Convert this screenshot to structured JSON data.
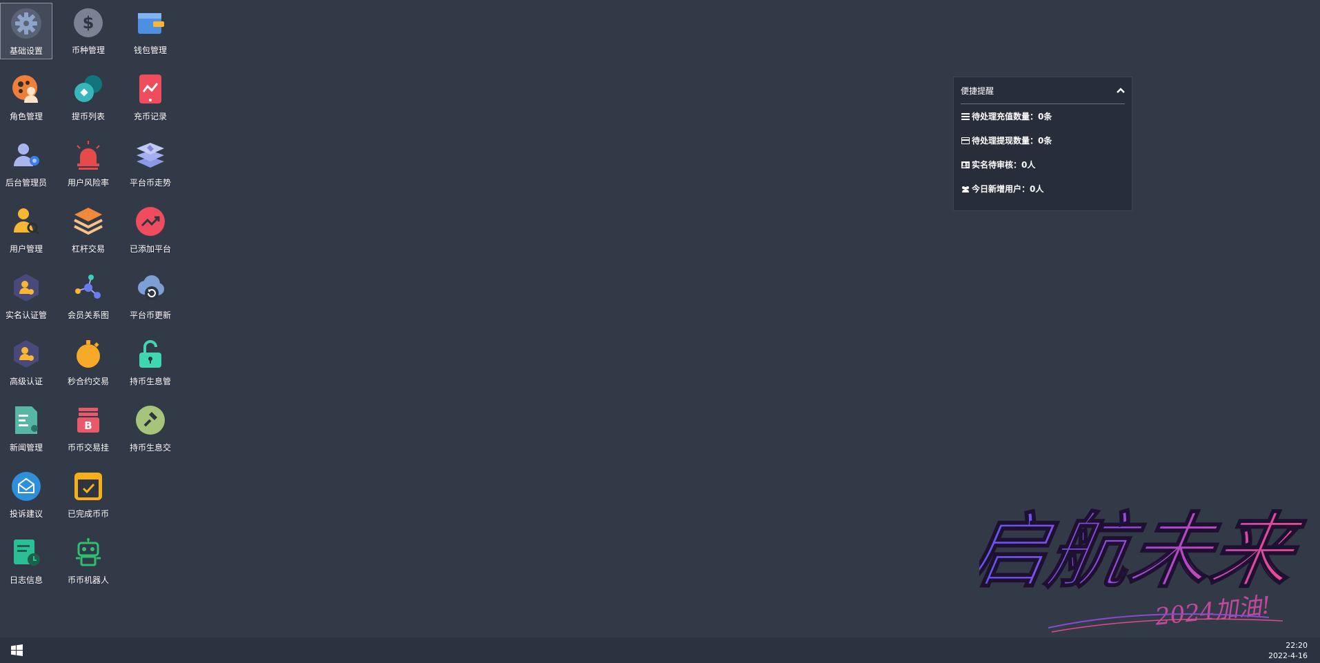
{
  "desktop": {
    "icons": [
      {
        "label": "基础设置"
      },
      {
        "label": "币种管理"
      },
      {
        "label": "钱包管理"
      },
      {
        "label": "角色管理"
      },
      {
        "label": "提币列表"
      },
      {
        "label": "充币记录"
      },
      {
        "label": "后台管理员"
      },
      {
        "label": "用户风险率"
      },
      {
        "label": "平台币走势"
      },
      {
        "label": "用户管理"
      },
      {
        "label": "杠杆交易"
      },
      {
        "label": "已添加平台"
      },
      {
        "label": "实名认证管"
      },
      {
        "label": "会员关系图"
      },
      {
        "label": "平台币更新"
      },
      {
        "label": "高级认证"
      },
      {
        "label": "秒合约交易"
      },
      {
        "label": "持币生息管"
      },
      {
        "label": "新闻管理"
      },
      {
        "label": "币币交易挂"
      },
      {
        "label": "持币生息交"
      },
      {
        "label": "投诉建议"
      },
      {
        "label": "已完成币币"
      },
      {
        "label": "日志信息"
      },
      {
        "label": "币币机器人"
      }
    ]
  },
  "panel": {
    "title": "便捷提醒",
    "rows": [
      {
        "label": "待处理充值数量：",
        "value": "0条"
      },
      {
        "label": "待处理提现数量：",
        "value": "0条"
      },
      {
        "label": "实名待审核：",
        "value": "0人"
      },
      {
        "label": "今日新增用户：",
        "value": "0人"
      }
    ]
  },
  "taskbar": {
    "time": "22:20",
    "date": "2022-4-16"
  },
  "wallpaper": {
    "text_main": "启航未来",
    "text_sub": "2024加油!"
  }
}
